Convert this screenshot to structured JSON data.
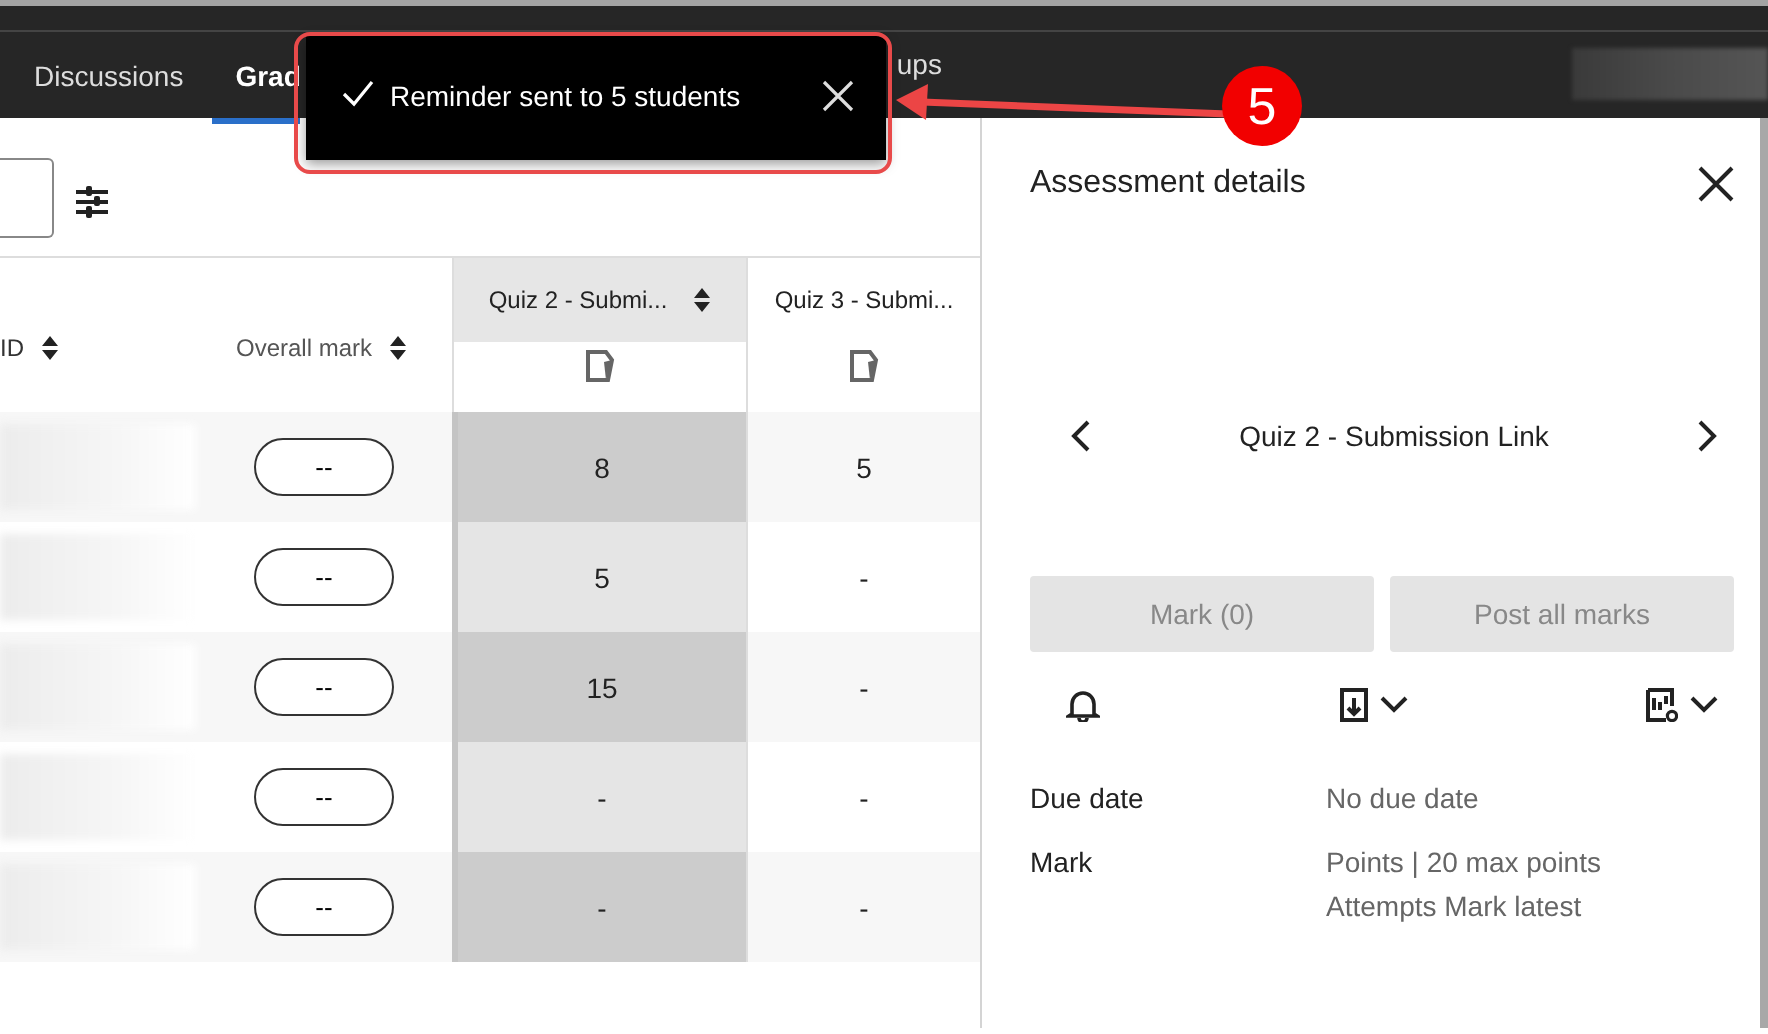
{
  "nav": {
    "tabs": [
      {
        "label": "Discussions",
        "selected": false
      },
      {
        "label": "Grad",
        "selected": true
      },
      {
        "label": "ups",
        "selected": false
      }
    ]
  },
  "toast": {
    "message": "Reminder sent to 5 students"
  },
  "annotation": {
    "step": "5"
  },
  "gradebook": {
    "id_column": "ID",
    "overall_column": "Overall mark",
    "quiz_columns": [
      {
        "label": "Quiz 2 - Submi...",
        "selected": true
      },
      {
        "label": "Quiz 3 - Submi...",
        "selected": false
      }
    ],
    "rows": [
      {
        "overall": "--",
        "quiz": [
          "8",
          "5"
        ]
      },
      {
        "overall": "--",
        "quiz": [
          "5",
          "-"
        ]
      },
      {
        "overall": "--",
        "quiz": [
          "15",
          "-"
        ]
      },
      {
        "overall": "--",
        "quiz": [
          "-",
          "-"
        ]
      },
      {
        "overall": "--",
        "quiz": [
          "-",
          "-"
        ]
      }
    ]
  },
  "panel": {
    "title": "Assessment details",
    "item": "Quiz 2 - Submission Link",
    "buttons": [
      {
        "label": "Mark (0)",
        "disabled": true
      },
      {
        "label": "Post all marks",
        "disabled": true
      }
    ],
    "details": [
      {
        "label": "Due date",
        "values": [
          "No due date"
        ]
      },
      {
        "label": "Mark",
        "values": [
          "Points | 20 max points",
          "Attempts Mark latest"
        ]
      }
    ]
  }
}
